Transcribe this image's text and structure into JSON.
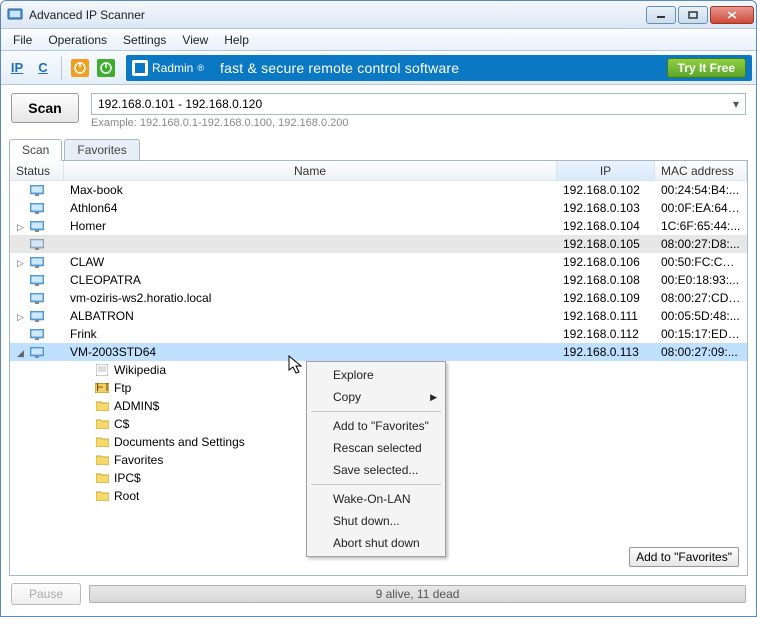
{
  "window": {
    "title": "Advanced IP Scanner"
  },
  "menu": [
    "File",
    "Operations",
    "Settings",
    "View",
    "Help"
  ],
  "promo": {
    "brand": "Radmin",
    "tagline": "fast & secure remote control software",
    "cta": "Try It Free"
  },
  "scan": {
    "button": "Scan",
    "value": "192.168.0.101 - 192.168.0.120",
    "example": "Example: 192.168.0.1-192.168.0.100, 192.168.0.200"
  },
  "tabs": {
    "scan": "Scan",
    "favorites": "Favorites"
  },
  "columns": {
    "status": "Status",
    "name": "Name",
    "ip": "IP",
    "mac": "MAC address"
  },
  "hosts": [
    {
      "name": "Max-book",
      "ip": "192.168.0.102",
      "mac": "00:24:54:B4:...",
      "alive": true
    },
    {
      "name": "Athlon64",
      "ip": "192.168.0.103",
      "mac": "00:0F:EA:64:...",
      "alive": true
    },
    {
      "name": "Homer",
      "ip": "192.168.0.104",
      "mac": "1C:6F:65:44:...",
      "alive": true,
      "expandable": true
    },
    {
      "name": "",
      "ip": "192.168.0.105",
      "mac": "08:00:27:D8:...",
      "alive": false
    },
    {
      "name": "CLAW",
      "ip": "192.168.0.106",
      "mac": "00:50:FC:C6:...",
      "alive": true,
      "expandable": true
    },
    {
      "name": "CLEOPATRA",
      "ip": "192.168.0.108",
      "mac": "00:E0:18:93:...",
      "alive": true
    },
    {
      "name": "vm-oziris-ws2.horatio.local",
      "ip": "192.168.0.109",
      "mac": "08:00:27:CD:...",
      "alive": true
    },
    {
      "name": "ALBATRON",
      "ip": "192.168.0.111",
      "mac": "00:05:5D:48:...",
      "alive": true,
      "expandable": true
    },
    {
      "name": "Frink",
      "ip": "192.168.0.112",
      "mac": "00:15:17:ED:...",
      "alive": true
    },
    {
      "name": "VM-2003STD64",
      "ip": "192.168.0.113",
      "mac": "08:00:27:09:...",
      "alive": true,
      "expanded": true,
      "selected": true
    }
  ],
  "children": [
    {
      "icon": "page",
      "name": "Wikipedia"
    },
    {
      "icon": "ftp",
      "name": "Ftp"
    },
    {
      "icon": "folder",
      "name": "ADMIN$"
    },
    {
      "icon": "folder",
      "name": "C$"
    },
    {
      "icon": "folder",
      "name": "Documents and Settings"
    },
    {
      "icon": "folder",
      "name": "Favorites"
    },
    {
      "icon": "folder",
      "name": "IPC$"
    },
    {
      "icon": "folder",
      "name": "Root"
    }
  ],
  "context_menu": {
    "explore": "Explore",
    "copy": "Copy",
    "add_fav": "Add to \"Favorites\"",
    "rescan": "Rescan selected",
    "save": "Save selected...",
    "wol": "Wake-On-LAN",
    "shutdown": "Shut down...",
    "abort": "Abort shut down"
  },
  "buttons": {
    "add_fav": "Add to \"Favorites\"",
    "pause": "Pause"
  },
  "status": "9 alive, 11 dead"
}
